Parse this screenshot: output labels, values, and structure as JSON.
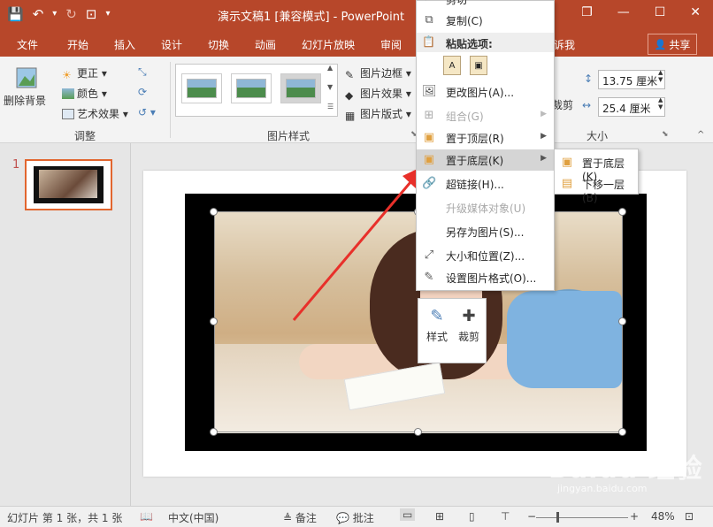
{
  "window": {
    "title": "演示文稿1 [兼容模式] - PowerPoint",
    "minimize": "—",
    "restore": "❐",
    "maximize": "☐",
    "close": "✕"
  },
  "qat": {
    "save": "💾",
    "undo": "↶",
    "undo_caret": "▾",
    "redo": "↻",
    "slideshow": "⊡",
    "customize": "▾"
  },
  "tabs": [
    "文件",
    "开始",
    "插入",
    "设计",
    "切换",
    "动画",
    "幻灯片放映",
    "审阅"
  ],
  "tell_me": "诉我",
  "share": {
    "icon": "👤",
    "label": "共享"
  },
  "ribbon": {
    "remove_bg": "删除背景",
    "correct": "更正 ▾",
    "color": "颜色 ▾",
    "art_effect": "艺术效果 ▾",
    "adjust_group": "调整",
    "picture_border": "图片边框 ▾",
    "picture_effect": "图片效果 ▾",
    "picture_layout": "图片版式 ▾",
    "styles_group": "图片样式",
    "crop": "裁剪",
    "height": "13.75 厘米",
    "width": "25.4 厘米",
    "size_group": "大小"
  },
  "context_menu": {
    "partial_top": "剪切",
    "items": [
      {
        "label": "复制(C)",
        "icon": "⧉",
        "disabled": false,
        "submenu": false,
        "highlight": false
      },
      {
        "label": "粘贴选项:",
        "icon": "📋",
        "section": true
      },
      {
        "label": "更改图片(A)...",
        "icon": "🖼",
        "disabled": false,
        "submenu": false,
        "highlight": false
      },
      {
        "label": "组合(G)",
        "icon": "⊞",
        "disabled": true,
        "submenu": true,
        "highlight": false
      },
      {
        "label": "置于顶层(R)",
        "icon": "▣",
        "disabled": false,
        "submenu": true,
        "highlight": false
      },
      {
        "label": "置于底层(K)",
        "icon": "▣",
        "disabled": false,
        "submenu": true,
        "highlight": true
      },
      {
        "label": "超链接(H)...",
        "icon": "🔗",
        "disabled": false,
        "submenu": false,
        "highlight": false
      },
      {
        "label": "升级媒体对象(U)",
        "icon": "",
        "disabled": true,
        "submenu": false,
        "highlight": false
      },
      {
        "label": "另存为图片(S)...",
        "icon": "",
        "disabled": false,
        "submenu": false,
        "highlight": false
      },
      {
        "label": "大小和位置(Z)...",
        "icon": "⤢",
        "disabled": false,
        "submenu": false,
        "highlight": false
      },
      {
        "label": "设置图片格式(O)...",
        "icon": "✎",
        "disabled": false,
        "submenu": false,
        "highlight": false
      }
    ]
  },
  "submenu": [
    "置于底层(K)",
    "下移一层(B)"
  ],
  "mini_toolbar": {
    "style": "样式",
    "crop": "裁剪"
  },
  "slides_pane": {
    "slide_number": "1"
  },
  "watermark": {
    "brand": "Baidu 经验",
    "url": "jingyan.baidu.com"
  },
  "status_bar": {
    "slide_info": "幻灯片 第 1 张，共 1 张",
    "language": "中文(中国)",
    "notes": "备注",
    "comments": "批注",
    "zoom": "48%",
    "zoom_minus": "−",
    "zoom_plus": "+"
  },
  "colors": {
    "accent": "#b7472a",
    "highlight": "#d5d5d5",
    "arrow": "#e8302a"
  }
}
